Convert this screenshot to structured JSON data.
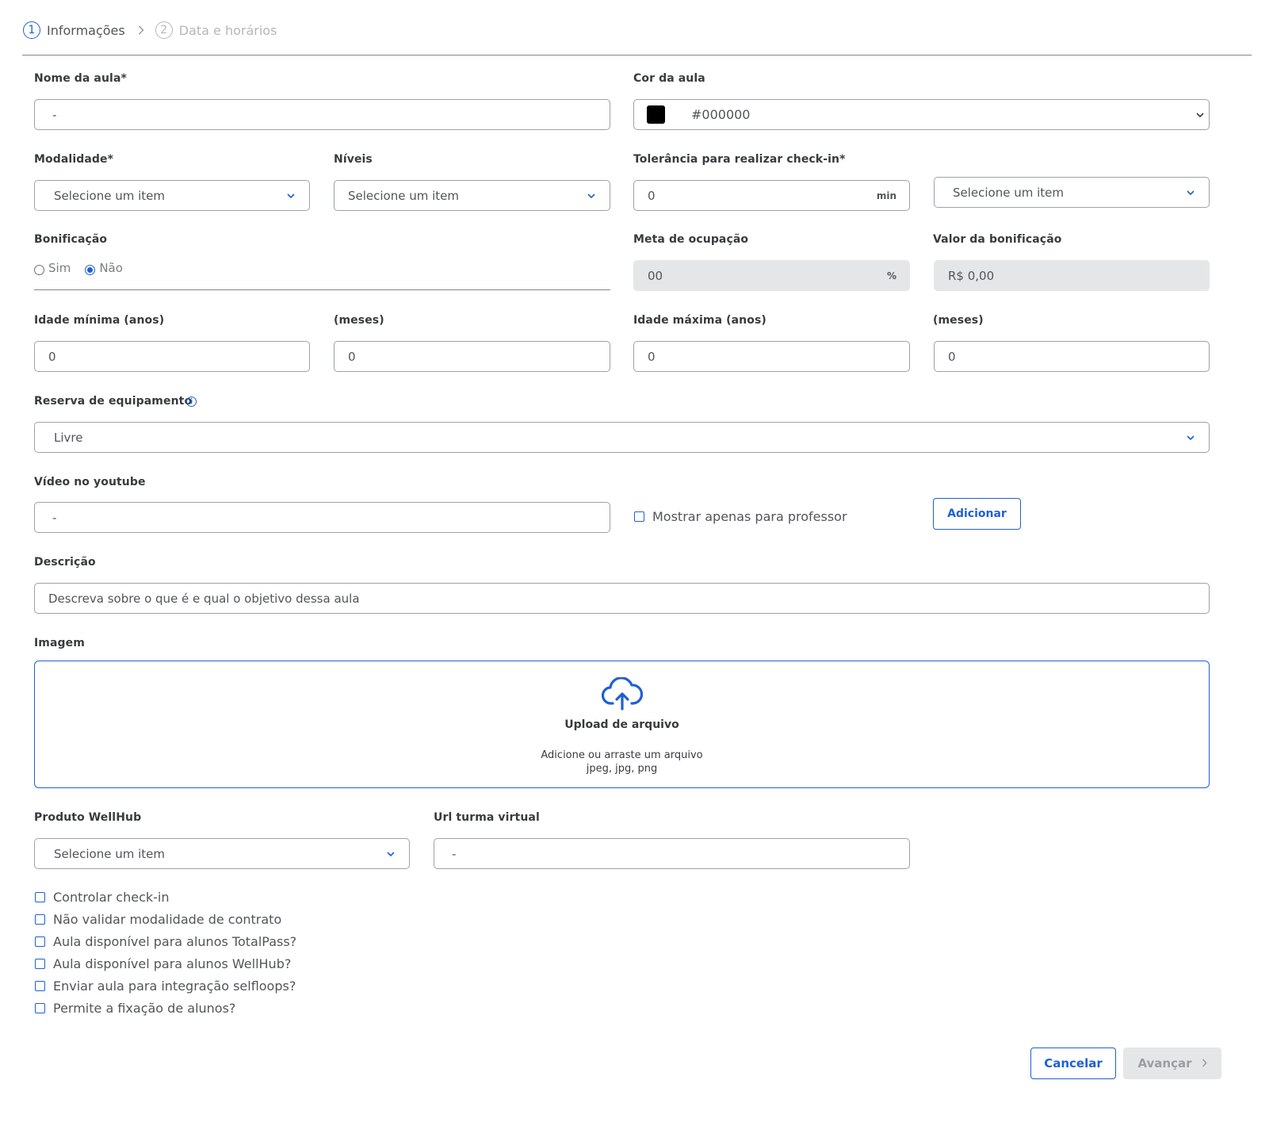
{
  "stepper": {
    "steps": [
      {
        "number": "1",
        "label": "Informações",
        "active": true
      },
      {
        "number": "2",
        "label": "Data e horários",
        "active": false
      }
    ]
  },
  "form": {
    "nome_aula": {
      "label": "Nome da aula*",
      "value": "-"
    },
    "cor_aula": {
      "label": "Cor da aula",
      "value": "#000000",
      "swatch": "#000000"
    },
    "modalidade": {
      "label": "Modalidade*",
      "value": "Selecione um item"
    },
    "niveis": {
      "label": "Níveis",
      "value": "Selecione um item"
    },
    "tolerancia": {
      "label": "Tolerância para realizar check-in*",
      "value": "0",
      "suffix": "min",
      "unit_select": "Selecione um item"
    },
    "bonificacao": {
      "label": "Bonificação",
      "options": [
        {
          "label": "Sim",
          "selected": false
        },
        {
          "label": "Não",
          "selected": true
        }
      ]
    },
    "meta_ocupacao": {
      "label": "Meta de ocupação",
      "value": "00",
      "suffix": "%"
    },
    "valor_bonificacao": {
      "label": "Valor da bonificação",
      "value": "R$ 0,00"
    },
    "idade_minima_anos": {
      "label": "Idade mínima (anos)",
      "value": "0"
    },
    "idade_minima_meses": {
      "label": "(meses)",
      "value": "0"
    },
    "idade_maxima_anos": {
      "label": "Idade máxima (anos)",
      "value": "0"
    },
    "idade_maxima_meses": {
      "label": "(meses)",
      "value": "0"
    },
    "reserva_equipamento": {
      "label": "Reserva de equipamento",
      "value": "Livre",
      "info_icon": "info-icon"
    },
    "video_youtube": {
      "label": "Vídeo no youtube",
      "value": "-",
      "checkbox_label": "Mostrar apenas para professor",
      "add_label": "Adicionar"
    },
    "descricao": {
      "label": "Descrição",
      "value": "Descreva sobre o que é e qual o objetivo dessa aula"
    },
    "imagem": {
      "label": "Imagem",
      "upload_title": "Upload de arquivo",
      "upload_hint": "Adicione ou arraste um arquivo",
      "upload_formats": "jpeg, jpg, png",
      "icon": "cloud-upload-icon"
    },
    "produto_wellhub": {
      "label": "Produto WellHub",
      "value": "Selecione um item"
    },
    "url_turma_virtual": {
      "label": "Url turma virtual",
      "value": "-"
    },
    "checkboxes": [
      "Controlar check-in",
      "Não validar modalidade de contrato",
      "Aula disponível para alunos TotalPass?",
      "Aula disponível para alunos WellHub?",
      "Enviar aula para integração selfloops?",
      "Permite a fixação de alunos?"
    ]
  },
  "footer": {
    "cancel_label": "Cancelar",
    "next_label": "Avançar"
  },
  "colors": {
    "accent": "#1e60d5",
    "disabled_bg": "#e5e6e8",
    "border": "#9da1a7"
  }
}
